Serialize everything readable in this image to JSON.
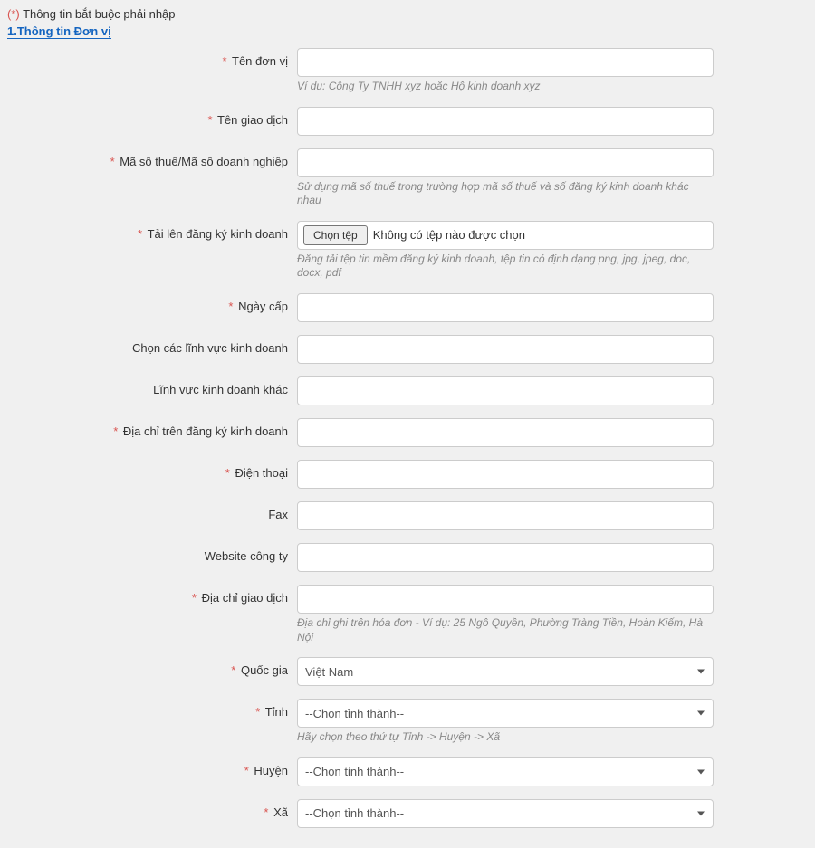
{
  "requiredNote": {
    "star": "(★)",
    "text": "Thông tin bắt buộc phải nhập"
  },
  "sectionTitle": "1.Thông tin Đơn vị",
  "fields": {
    "tenDonVi": {
      "label": "Tên đơn vị",
      "help": "Ví dụ: Công Ty TNHH xyz hoặc Hộ kinh doanh xyz"
    },
    "tenGiaoDich": {
      "label": "Tên giao dịch"
    },
    "maSoThue": {
      "label": "Mã số thuế/Mã số doanh nghiệp",
      "help": "Sử dụng mã số thuế trong trường hợp mã số thuế và số đăng ký kinh doanh khác nhau"
    },
    "taiLen": {
      "label": "Tải lên đăng ký kinh doanh",
      "button": "Chọn tệp",
      "noFile": "Không có tệp nào được chọn",
      "help": "Đăng tải tệp tin mềm đăng ký kinh doanh, tệp tin có định dạng png, jpg, jpeg, doc, docx, pdf"
    },
    "ngayCap": {
      "label": "Ngày cấp"
    },
    "linhVuc": {
      "label": "Chọn các lĩnh vực kinh doanh"
    },
    "linhVucKhac": {
      "label": "Lĩnh vực kinh doanh khác"
    },
    "diaChiDKKD": {
      "label": "Địa chỉ trên đăng ký kinh doanh"
    },
    "dienThoai": {
      "label": "Điện thoại"
    },
    "fax": {
      "label": "Fax"
    },
    "website": {
      "label": "Website công ty"
    },
    "diaChiGD": {
      "label": "Địa chỉ giao dịch",
      "help": "Địa chỉ ghi trên hóa đơn - Ví dụ: 25 Ngô Quyền, Phường Tràng Tiền, Hoàn Kiếm, Hà Nội"
    },
    "quocGia": {
      "label": "Quốc gia",
      "selected": "Việt Nam"
    },
    "tinh": {
      "label": "Tỉnh",
      "selected": "--Chọn tỉnh thành--",
      "help": "Hãy chọn theo thứ tự Tỉnh -> Huyện -> Xã"
    },
    "huyen": {
      "label": "Huyện",
      "selected": "--Chọn tỉnh thành--"
    },
    "xa": {
      "label": "Xã",
      "selected": "--Chọn tỉnh thành--"
    }
  }
}
